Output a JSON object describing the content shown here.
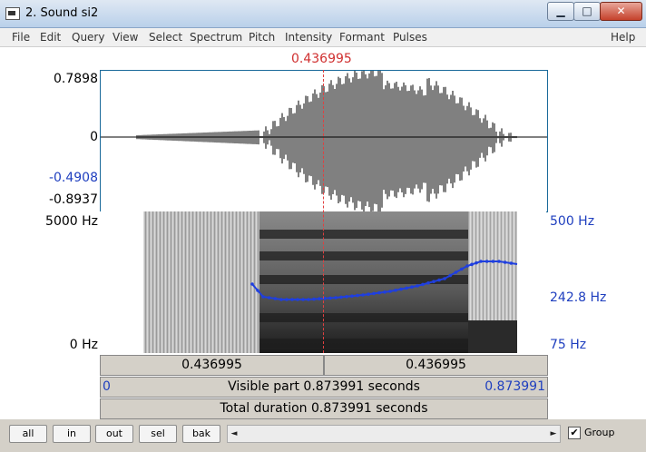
{
  "window": {
    "title": "2. Sound si2",
    "minimize": "▁",
    "maximize": "□",
    "close": "✕"
  },
  "menu": [
    "File",
    "Edit",
    "Query",
    "View",
    "Select",
    "Spectrum",
    "Pitch",
    "Intensity",
    "Formant",
    "Pulses",
    "Help"
  ],
  "waveform": {
    "cursor_time": "0.436995",
    "y_max": "0.7898",
    "y_zero": "0",
    "y_cursor_value": "-0.4908",
    "y_min": "-0.8937"
  },
  "spectrogram": {
    "freq_top": "5000 Hz",
    "freq_bottom": "0 Hz",
    "pitch_top": "500 Hz",
    "pitch_mid": "242.8 Hz",
    "pitch_bottom": "75 Hz"
  },
  "selection_bar": {
    "left_segment": "0.436995",
    "right_segment": "0.436995"
  },
  "visible_bar": {
    "start": "0",
    "label": "Visible part 0.873991 seconds",
    "end": "0.873991"
  },
  "total_bar": {
    "label": "Total duration 0.873991 seconds"
  },
  "toolbar": {
    "buttons": [
      "all",
      "in",
      "out",
      "sel",
      "bak"
    ],
    "scroll_left": "◄",
    "scroll_right": "►",
    "group_checkbox": "✔",
    "group_label": "Group",
    "group_checked": true
  }
}
